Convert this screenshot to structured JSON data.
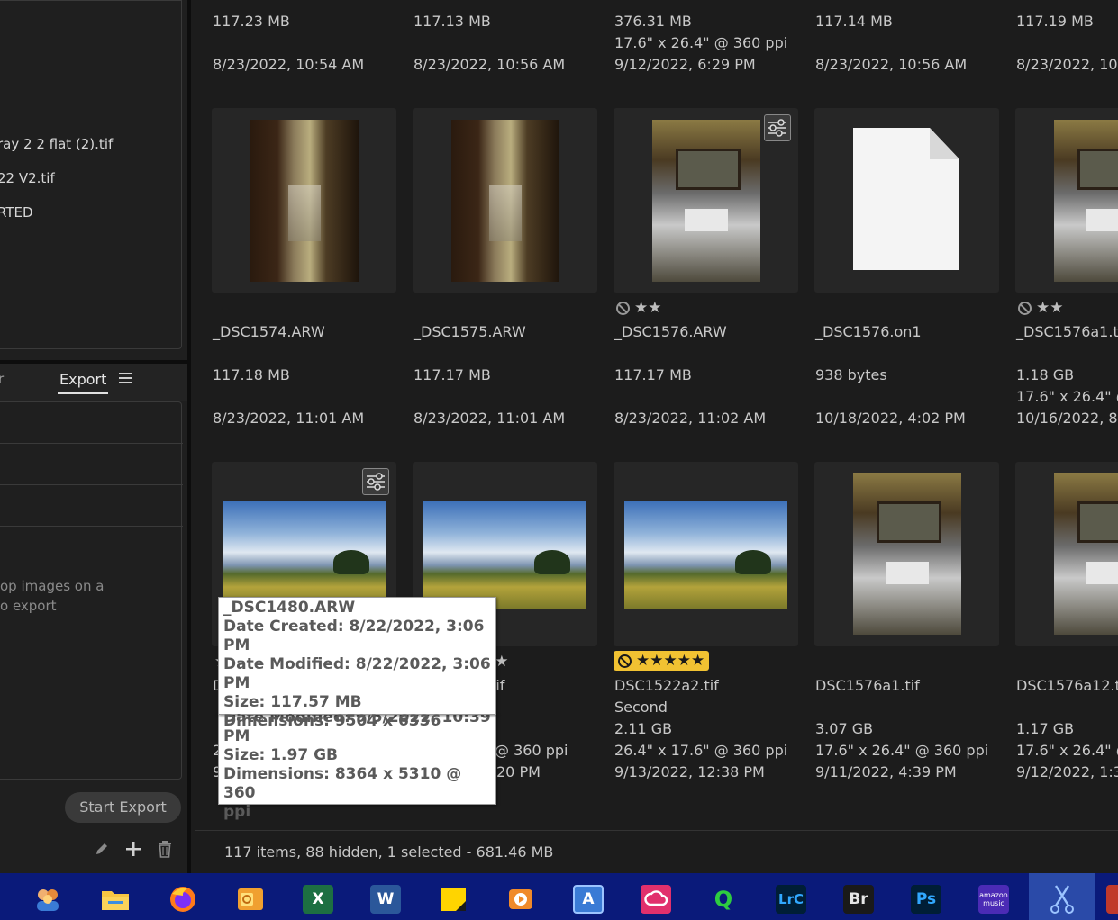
{
  "left_panel": {
    "recent_items": [
      "ray 2 2 flat (2).tif",
      "22 V2.tif",
      "RTED"
    ],
    "tab_left": "r",
    "export_tab": "Export",
    "drop_text_line1": "op images on a",
    "drop_text_line2": "o export",
    "start_export": "Start Export"
  },
  "top_row": [
    {
      "size": "117.23 MB",
      "line2": "",
      "date": "8/23/2022, 10:54 AM"
    },
    {
      "size": "117.13 MB",
      "line2": "",
      "date": "8/23/2022, 10:56 AM"
    },
    {
      "size": "376.31 MB",
      "line2": "17.6\" x 26.4\" @ 360 ppi",
      "date": "9/12/2022, 6:29 PM"
    },
    {
      "size": "117.14 MB",
      "line2": "",
      "date": "8/23/2022, 10:56 AM"
    },
    {
      "size": "117.19 MB",
      "line2": "",
      "date": "8/23/2022, 10:5"
    }
  ],
  "middle_row": [
    {
      "name": "_DSC1574.ARW",
      "size": "117.18 MB",
      "dims": "",
      "date": "8/23/2022, 11:01 AM",
      "rating": ""
    },
    {
      "name": "_DSC1575.ARW",
      "size": "117.17 MB",
      "dims": "",
      "date": "8/23/2022, 11:01 AM",
      "rating": ""
    },
    {
      "name": "_DSC1576.ARW",
      "size": "117.17 MB",
      "dims": "",
      "date": "8/23/2022, 11:02 AM",
      "rating": "★★"
    },
    {
      "name": "_DSC1576.on1",
      "size": "938 bytes",
      "dims": "",
      "date": "10/18/2022, 4:02 PM",
      "rating": ""
    },
    {
      "name": "_DSC1576a1.tif",
      "size": "1.18 GB",
      "dims": "17.6\" x 26.4\" @ 3",
      "date": "10/16/2022, 8:3",
      "rating": "★★"
    }
  ],
  "bottom_row": [
    {
      "name": "D",
      "subtitle": "",
      "size": "2",
      "dims": "",
      "date": "9",
      "rating": "★"
    },
    {
      "name": ".tif",
      "subtitle": "",
      "size": "",
      "dims": "@ 360 ppi",
      "date": "20 PM",
      "rating": "★★"
    },
    {
      "name": "DSC1522a2.tif",
      "subtitle": "Second",
      "size": "2.11 GB",
      "dims": "26.4\" x 17.6\" @ 360 ppi",
      "date": "9/13/2022, 12:38 PM",
      "rating": "★★★★★"
    },
    {
      "name": "DSC1576a1.tif",
      "subtitle": "",
      "size": "3.07 GB",
      "dims": "17.6\" x 26.4\" @ 360 ppi",
      "date": "9/11/2022, 4:39 PM",
      "rating": ""
    },
    {
      "name": "DSC1576a12.tif",
      "subtitle": "",
      "size": "1.17 GB",
      "dims": "17.6\" x 26.4\" @ 3",
      "date": "9/12/2022, 1:38",
      "rating": ""
    }
  ],
  "tooltip_front": {
    "line1": "_DSC1480.ARW",
    "line2": "Date Created: 8/22/2022, 3:06 PM",
    "line3": "Date Modified: 8/22/2022, 3:06",
    "line4": "PM",
    "line5": "Size: 117.57 MB",
    "line6": "Dimensions: 9504 x 6336"
  },
  "tooltip_back": {
    "line1": "Date Modified: 9/5/2022, 10:39",
    "line2": "PM",
    "line3": "Size: 1.97 GB",
    "line4": "Dimensions: 8364 x 5310 @ 360",
    "line5": "ppi"
  },
  "status": "117 items, 88 hidden, 1 selected - 681.46 MB",
  "taskbar": {
    "icons": [
      "people-icon",
      "file-explorer-icon",
      "firefox-icon",
      "outlook-icon",
      "excel-icon",
      "word-icon",
      "sticky-notes-icon",
      "video-editor-icon",
      "typing-app-icon",
      "creative-cloud-icon",
      "quicken-icon",
      "lightroom-classic-icon",
      "bridge-icon",
      "photoshop-icon",
      "amazon-music-icon",
      "snipping-tool-icon"
    ],
    "labels": {
      "word": "W",
      "excel": "X",
      "lrc": "LrC",
      "br": "Br",
      "ps": "Ps",
      "quicken": "Q",
      "typing": "A",
      "amazon_top": "amazon",
      "amazon_bottom": "music"
    }
  },
  "colors": {
    "background": "#1c1c1c",
    "thumb_bg": "#262626",
    "taskbar": "#0a1a7a",
    "rating_gold": "#f1c232"
  }
}
